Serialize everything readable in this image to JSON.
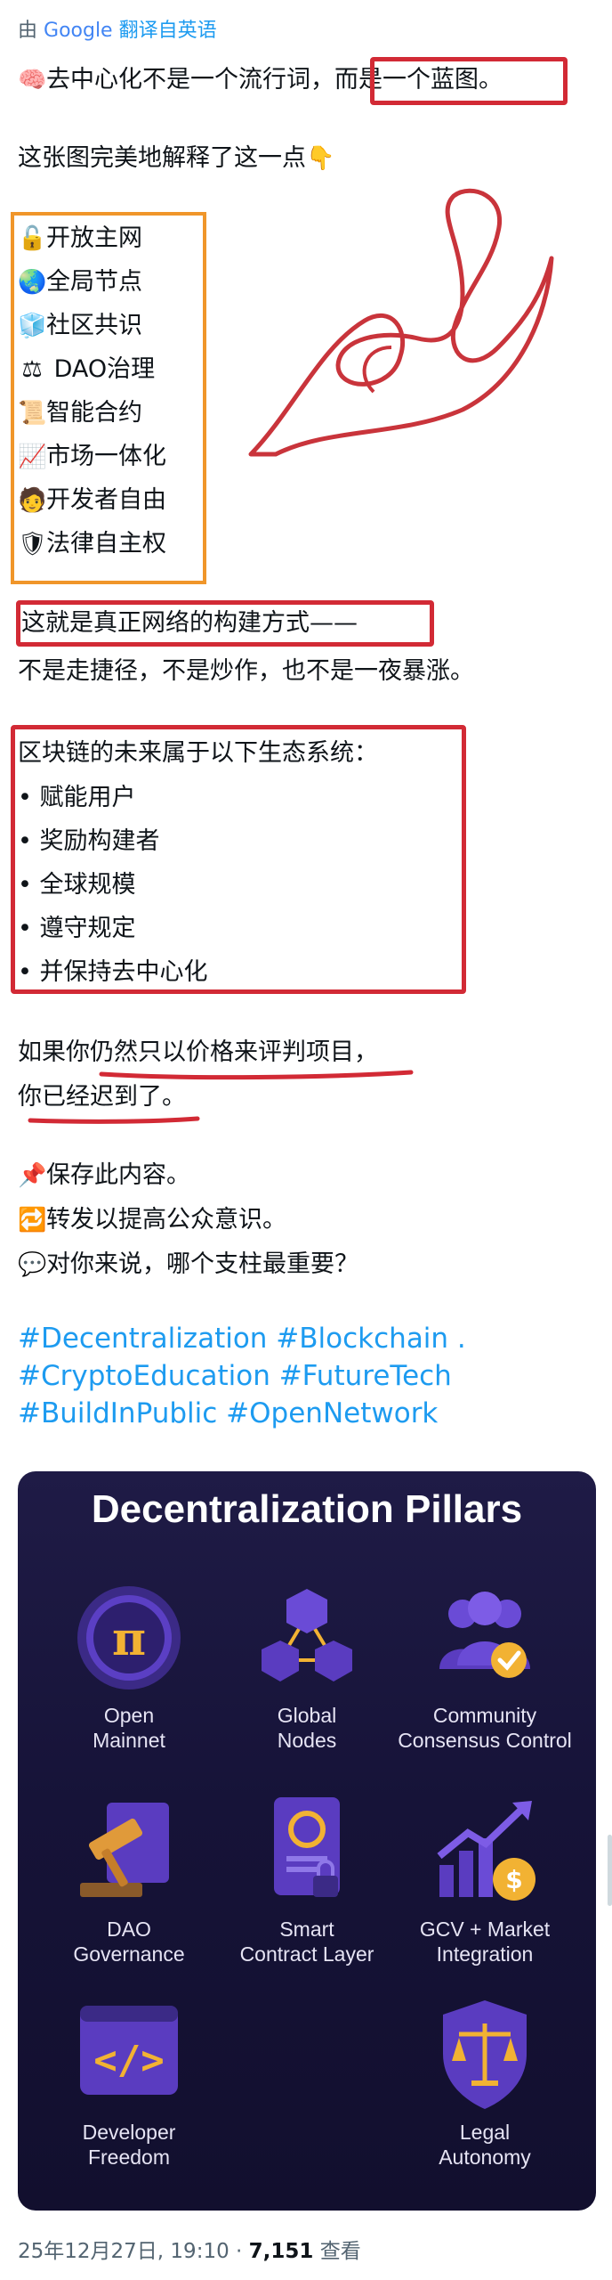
{
  "translate": {
    "prefix": "由",
    "google": "Google",
    "link": "翻译自英语"
  },
  "post": {
    "headline_part1": "去中心化不是一个流行词，",
    "headline_part2": "而是一个蓝图。",
    "headline_icon": "brain-icon",
    "intro": "这张图完美地解释了这一点",
    "intro_icon": "pointing-down-icon",
    "pillars_list": [
      {
        "icon": "lock-icon",
        "glyph": "🔓",
        "text": "开放主网"
      },
      {
        "icon": "globe-icon",
        "glyph": "🌏",
        "text": "全局节点"
      },
      {
        "icon": "box-icon",
        "glyph": "🧊",
        "text": "社区共识"
      },
      {
        "icon": "scales-icon",
        "glyph": "⚖",
        "text": " DAO治理"
      },
      {
        "icon": "scroll-icon",
        "glyph": "📜",
        "text": "智能合约"
      },
      {
        "icon": "chart-up-icon",
        "glyph": "📈",
        "text": "市场一体化"
      },
      {
        "icon": "developer-icon",
        "glyph": "🧑",
        "text": "开发者自由"
      },
      {
        "icon": "shield-icon",
        "glyph": "🛡",
        "text": "法律自主权"
      }
    ],
    "build_line1": "这就是真正网络的构建方式——",
    "build_line2": "不是走捷径，不是炒作，也不是一夜暴涨。",
    "future_title": "区块链的未来属于以下生态系统：",
    "future_items": [
      "• 赋能用户",
      "• 奖励构建者",
      "• 全球规模",
      "• 遵守规定",
      "• 并保持去中心化"
    ],
    "late_line1": "如果你仍然只以价格来评判项目，",
    "late_line2": "你已经迟到了。",
    "actions": [
      {
        "icon": "pin-icon",
        "glyph": "📌",
        "text": "保存此内容。"
      },
      {
        "icon": "repeat-icon",
        "glyph": "🔁",
        "text": "转发以提高公众意识。"
      },
      {
        "icon": "speech-icon",
        "glyph": "💬",
        "text": "对你来说，哪个支柱最重要？"
      }
    ],
    "hashtags": [
      "#Decentralization #Blockchain .",
      "#CryptoEducation #FutureTech",
      "#BuildInPublic #OpenNetwork"
    ]
  },
  "card": {
    "title": "Decentralization Pillars",
    "pillars": [
      {
        "label": "Open\nMainnet",
        "icon": "pi-coin-icon"
      },
      {
        "label": "Global\nNodes",
        "icon": "cubes-network-icon"
      },
      {
        "label": "Community\nConsensus Control",
        "icon": "people-check-icon"
      },
      {
        "label": "DAO\nGovernance",
        "icon": "gavel-icon"
      },
      {
        "label": "Smart\nContract Layer",
        "icon": "contract-lock-icon"
      },
      {
        "label": "GCV + Market\nIntegration",
        "icon": "growth-coin-icon"
      },
      {
        "label": "Developer\nFreedom",
        "icon": "code-icon"
      },
      {
        "label": "Legal\nAutonomy",
        "icon": "scales-shield-icon"
      }
    ]
  },
  "footer": {
    "date": "25年12月27日, 19:10 · ",
    "views": "7,151",
    "views_label": " 查看"
  },
  "colors": {
    "highlight_red": "#d22a35",
    "highlight_orange": "#f0962a",
    "hashtag_blue": "#1d9bf0",
    "card_bg": "#1a1640"
  }
}
